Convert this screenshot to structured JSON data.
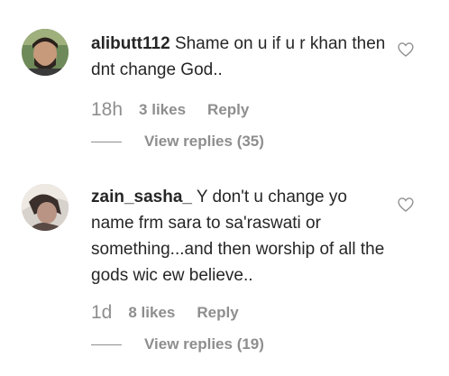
{
  "comments": [
    {
      "username": "alibutt112",
      "text": "Shame on u if u r khan then dnt change God..",
      "time": "18h",
      "likes": "3 likes",
      "reply_label": "Reply",
      "view_replies": "View replies (35)"
    },
    {
      "username": "zain_sasha_",
      "text": "Y don't u change yo name frm sara to sa'raswati or something...and then worship of all the gods wic ew believe..",
      "time": "1d",
      "likes": "8 likes",
      "reply_label": "Reply",
      "view_replies": "View replies (19)"
    }
  ],
  "icons": {
    "like": "heart-outline-icon"
  },
  "colors": {
    "text": "#262626",
    "secondary": "#8e8e8e"
  }
}
